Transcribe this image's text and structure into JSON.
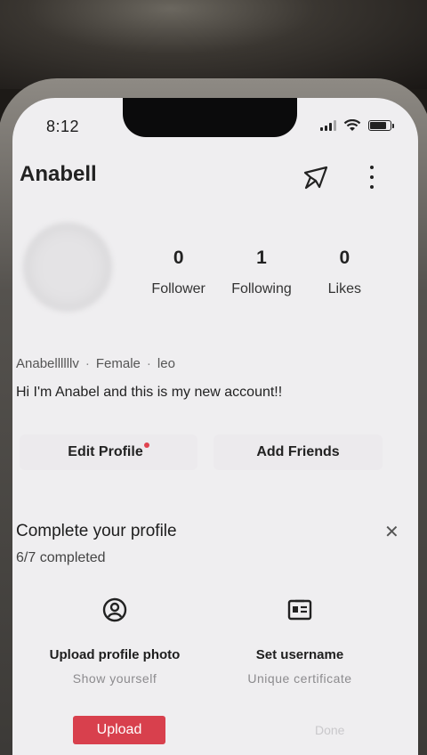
{
  "status_bar": {
    "time": "8:12"
  },
  "header": {
    "title": "Anabell"
  },
  "profile": {
    "stats": [
      {
        "value": "0",
        "label": "Follower"
      },
      {
        "value": "1",
        "label": "Following"
      },
      {
        "value": "0",
        "label": "Likes"
      }
    ],
    "meta": {
      "username": "Anabellllllv",
      "gender": "Female",
      "zodiac": "leo"
    },
    "bio": "Hi I'm Anabel and this is my new account!!"
  },
  "actions": {
    "edit_label": "Edit Profile",
    "add_label": "Add Friends"
  },
  "completion": {
    "title": "Complete your profile",
    "progress": "6/7 completed",
    "cards": [
      {
        "title": "Upload  profile photo",
        "subtitle": "Show yourself",
        "button": "Upload"
      },
      {
        "title": "Set username",
        "subtitle": "Unique  certificate",
        "button": "Done"
      }
    ]
  },
  "colors": {
    "accent": "#d8404d",
    "notification_dot": "#e0434f",
    "screen_bg": "#efeef0"
  },
  "icons": [
    "share-icon",
    "more-icon",
    "close-icon",
    "user-circle-icon",
    "id-card-icon",
    "signal-icon",
    "wifi-icon",
    "battery-icon"
  ]
}
